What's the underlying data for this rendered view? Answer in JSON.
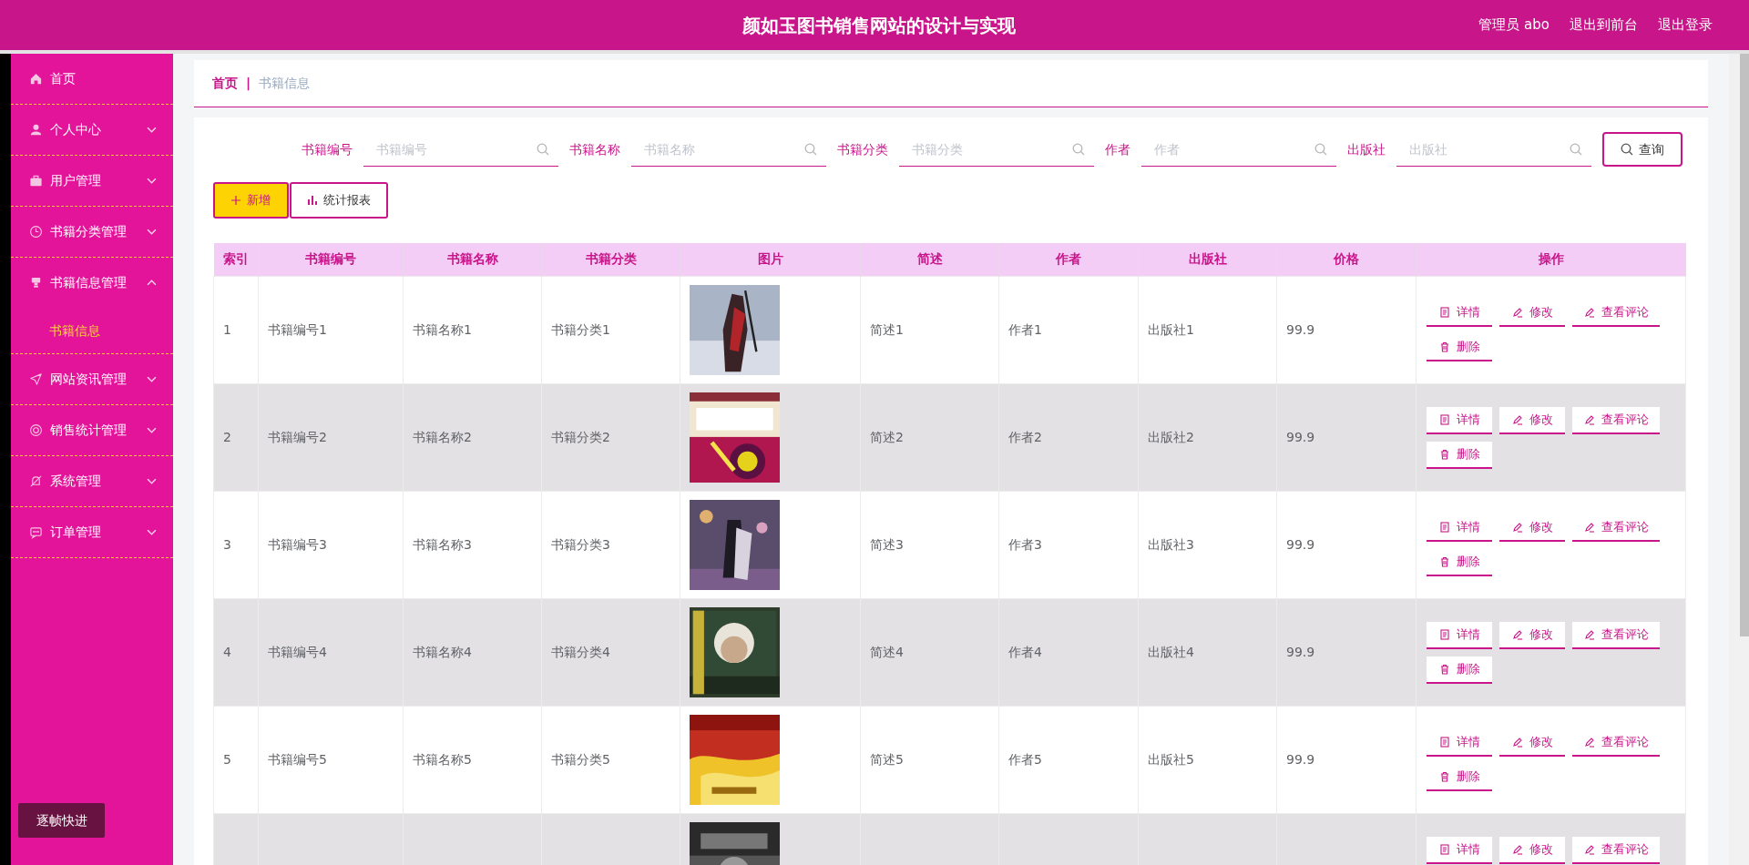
{
  "header": {
    "title": "颜如玉图书销售网站的设计与实现",
    "links": [
      "管理员 abo",
      "退出到前台",
      "退出登录"
    ]
  },
  "sidebar": {
    "items": [
      {
        "label": "首页",
        "expandable": false
      },
      {
        "label": "个人中心",
        "expandable": true,
        "expanded": false
      },
      {
        "label": "用户管理",
        "expandable": true,
        "expanded": false
      },
      {
        "label": "书籍分类管理",
        "expandable": true,
        "expanded": false
      },
      {
        "label": "书籍信息管理",
        "expandable": true,
        "expanded": true,
        "children": [
          {
            "label": "书籍信息",
            "selected": true
          }
        ]
      },
      {
        "label": "网站资讯管理",
        "expandable": true,
        "expanded": false
      },
      {
        "label": "销售统计管理",
        "expandable": true,
        "expanded": false
      },
      {
        "label": "系统管理",
        "expandable": true,
        "expanded": false
      },
      {
        "label": "订单管理",
        "expandable": true,
        "expanded": false
      }
    ],
    "footer_button": "逐帧快进"
  },
  "breadcrumb": {
    "items": [
      "首页",
      "书籍信息"
    ],
    "separator": "|"
  },
  "search": {
    "fields": [
      {
        "label": "书籍编号",
        "placeholder": "书籍编号"
      },
      {
        "label": "书籍名称",
        "placeholder": "书籍名称"
      },
      {
        "label": "书籍分类",
        "placeholder": "书籍分类"
      },
      {
        "label": "作者",
        "placeholder": "作者"
      },
      {
        "label": "出版社",
        "placeholder": "出版社"
      }
    ],
    "button": "查询"
  },
  "toolbar": [
    {
      "kind": "add",
      "label": "新增"
    },
    {
      "kind": "chart",
      "label": "统计报表"
    }
  ],
  "table": {
    "columns": [
      "索引",
      "书籍编号",
      "书籍名称",
      "书籍分类",
      "图片",
      "简述",
      "作者",
      "出版社",
      "价格",
      "操作"
    ],
    "rows": [
      {
        "cells": [
          "1",
          "书籍编号1",
          "书籍名称1",
          "书籍分类1",
          "",
          "简述1",
          "作者1",
          "出版社1",
          "99.9"
        ],
        "image": {
          "kind": "picture"
        },
        "actions": [
          {
            "kind": "detail",
            "label": "详情"
          },
          {
            "kind": "edit",
            "label": "修改"
          },
          {
            "kind": "comment",
            "label": "查看评论"
          },
          {
            "kind": "delete",
            "label": "删除"
          }
        ]
      },
      {
        "cells": [
          "2",
          "书籍编号2",
          "书籍名称2",
          "书籍分类2",
          "",
          "简述2",
          "作者2",
          "出版社2",
          "99.9"
        ],
        "image": {
          "kind": "picture"
        },
        "actions": [
          {
            "kind": "detail",
            "label": "详情"
          },
          {
            "kind": "edit",
            "label": "修改"
          },
          {
            "kind": "comment",
            "label": "查看评论"
          },
          {
            "kind": "delete",
            "label": "删除"
          }
        ]
      },
      {
        "cells": [
          "3",
          "书籍编号3",
          "书籍名称3",
          "书籍分类3",
          "",
          "简述3",
          "作者3",
          "出版社3",
          "99.9"
        ],
        "image": {
          "kind": "picture"
        },
        "actions": [
          {
            "kind": "detail",
            "label": "详情"
          },
          {
            "kind": "edit",
            "label": "修改"
          },
          {
            "kind": "comment",
            "label": "查看评论"
          },
          {
            "kind": "delete",
            "label": "删除"
          }
        ]
      },
      {
        "cells": [
          "4",
          "书籍编号4",
          "书籍名称4",
          "书籍分类4",
          "",
          "简述4",
          "作者4",
          "出版社4",
          "99.9"
        ],
        "image": {
          "kind": "picture"
        },
        "actions": [
          {
            "kind": "detail",
            "label": "详情"
          },
          {
            "kind": "edit",
            "label": "修改"
          },
          {
            "kind": "comment",
            "label": "查看评论"
          },
          {
            "kind": "delete",
            "label": "删除"
          }
        ]
      },
      {
        "cells": [
          "5",
          "书籍编号5",
          "书籍名称5",
          "书籍分类5",
          "",
          "简述5",
          "作者5",
          "出版社5",
          "99.9"
        ],
        "image": {
          "kind": "picture"
        },
        "actions": [
          {
            "kind": "detail",
            "label": "详情"
          },
          {
            "kind": "edit",
            "label": "修改"
          },
          {
            "kind": "comment",
            "label": "查看评论"
          },
          {
            "kind": "delete",
            "label": "删除"
          }
        ]
      },
      {
        "image": {
          "kind": "picture"
        },
        "actions": [
          {
            "kind": "detail",
            "label": "详情"
          },
          {
            "kind": "edit",
            "label": "修改"
          },
          {
            "kind": "comment",
            "label": "查看评论"
          }
        ]
      }
    ]
  }
}
